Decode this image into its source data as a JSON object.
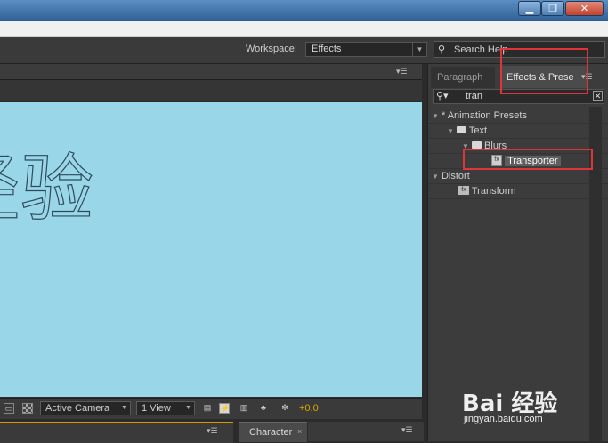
{
  "window": {
    "minimize_glyph": "▁",
    "maximize_glyph": "❐",
    "close_glyph": "✕"
  },
  "toolbar": {
    "workspace_label": "Workspace:",
    "workspace_value": "Effects",
    "help_search_placeholder": "Search Help"
  },
  "composition": {
    "canvas_text": "经验",
    "camera": "Active Camera",
    "view_count": "1 View",
    "exposure": "+0.0",
    "background_color": "#99d7e8"
  },
  "right_panel": {
    "tabs": [
      {
        "label": "Paragraph",
        "active": false
      },
      {
        "label": "Effects & Prese",
        "active": true
      }
    ],
    "search_value": "tran",
    "tree": [
      {
        "label": "* Animation Presets",
        "level": 0,
        "kind": "category"
      },
      {
        "label": "Text",
        "level": 1,
        "kind": "folder"
      },
      {
        "label": "Blurs",
        "level": 2,
        "kind": "folder"
      },
      {
        "label": "Transporter",
        "level": 3,
        "kind": "preset",
        "selected": true
      },
      {
        "label": "Distort",
        "level": 0,
        "kind": "category"
      },
      {
        "label": "Transform",
        "level": 1,
        "kind": "effect"
      }
    ]
  },
  "bottom_tabs": {
    "character_label": "Character",
    "character_close": "×"
  },
  "watermark": {
    "brand": "Bai 经验",
    "url": "jingyan.baidu.com"
  },
  "colors": {
    "highlight": "#e0343a",
    "exposure": "#e0a400"
  }
}
